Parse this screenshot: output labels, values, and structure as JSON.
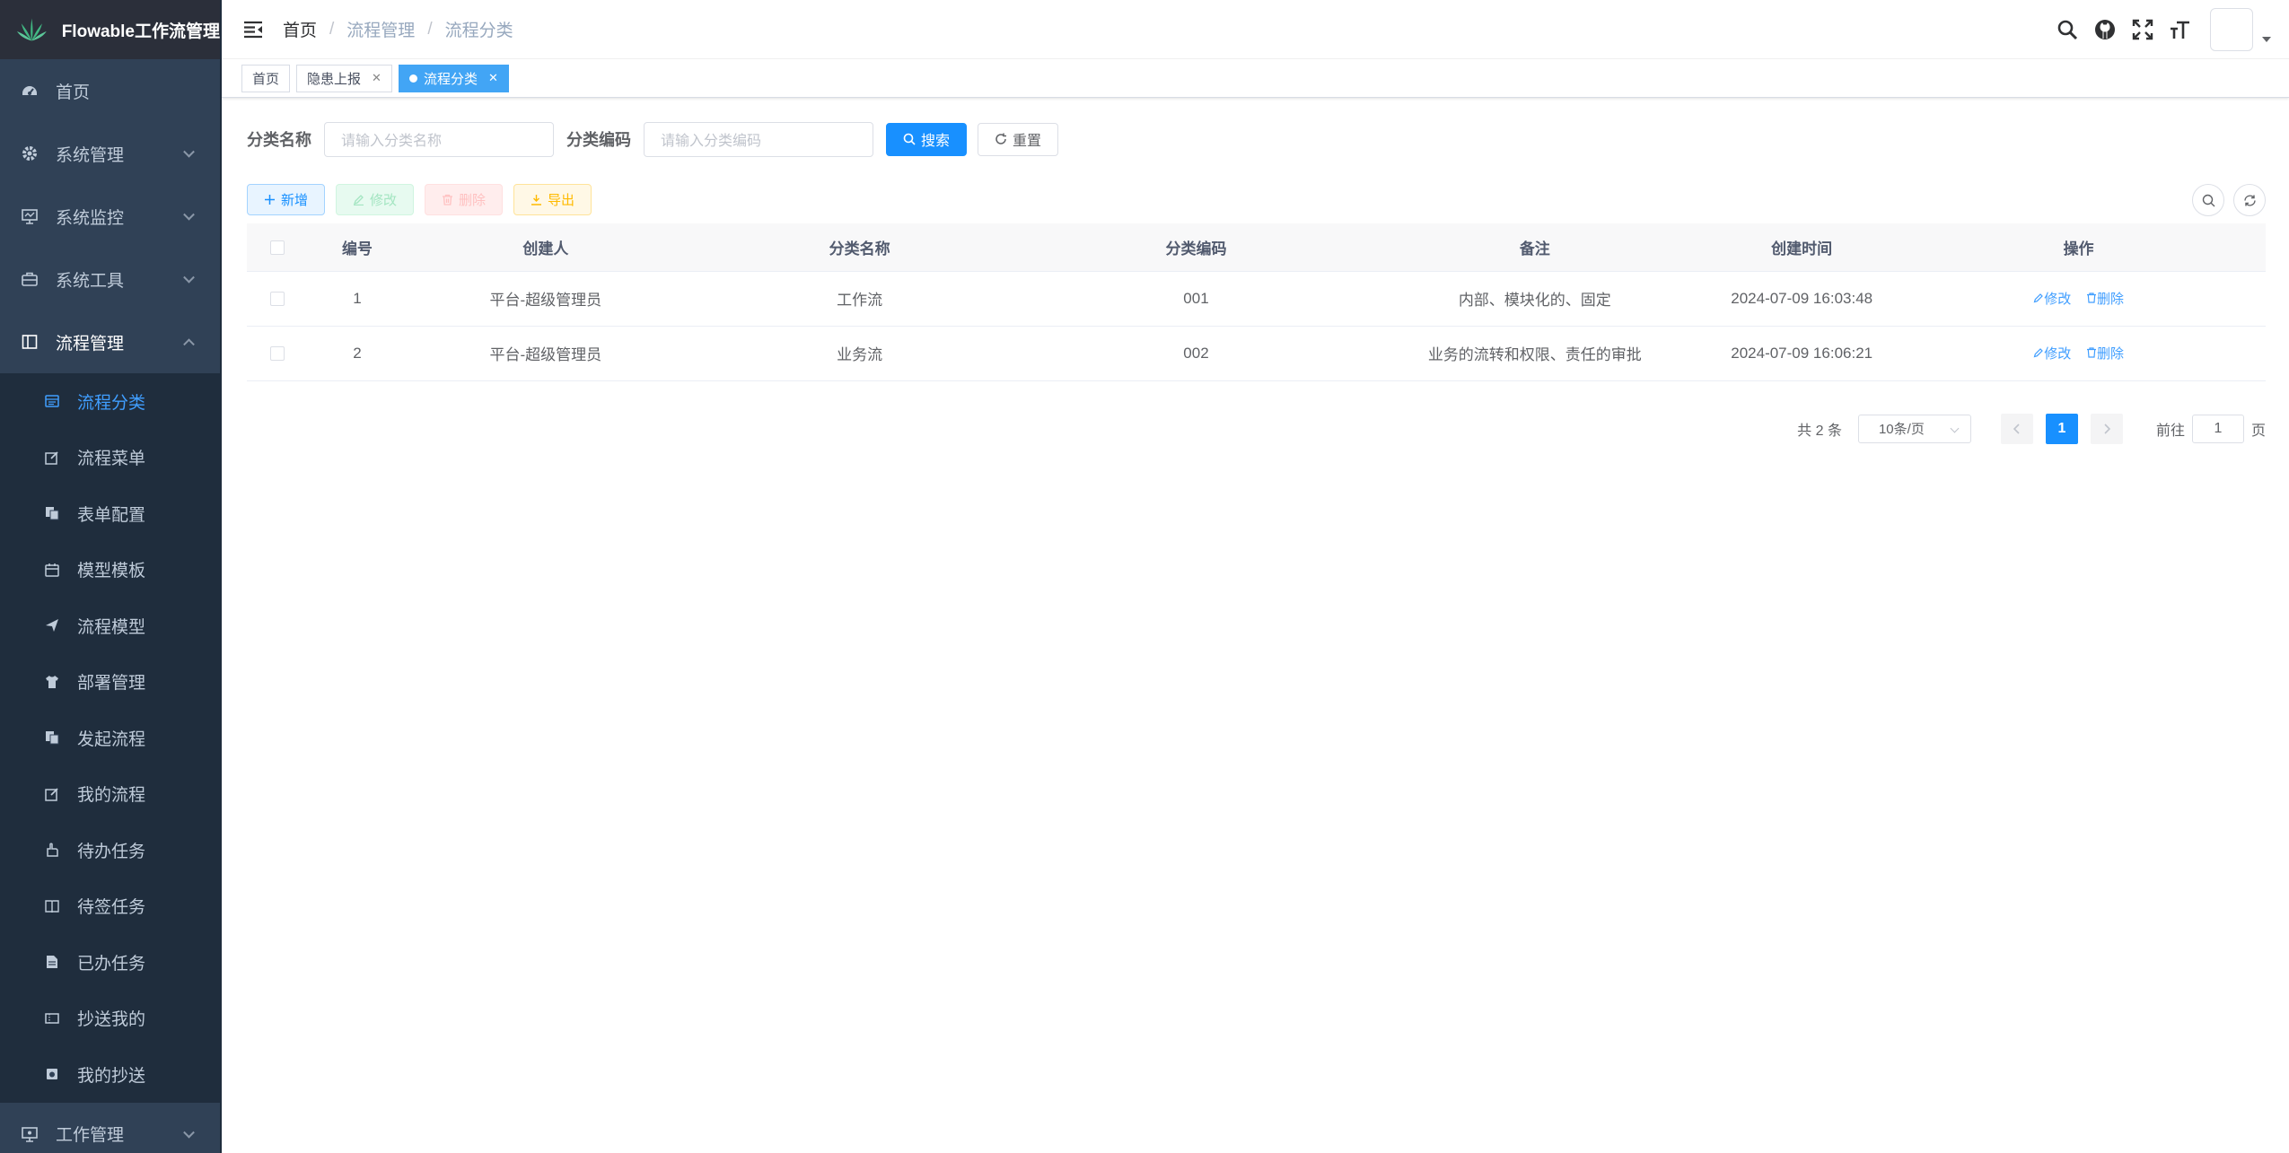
{
  "app": {
    "title": "Flowable工作流管理"
  },
  "sidebar": {
    "items": [
      {
        "label": "首页",
        "icon": "dashboard-icon"
      },
      {
        "label": "系统管理",
        "icon": "gear-icon"
      },
      {
        "label": "系统监控",
        "icon": "monitor-icon"
      },
      {
        "label": "系统工具",
        "icon": "toolbox-icon"
      },
      {
        "label": "流程管理",
        "icon": "layout-icon"
      }
    ],
    "submenu": [
      {
        "label": "流程分类",
        "icon": "list-icon"
      },
      {
        "label": "流程菜单",
        "icon": "edit-icon"
      },
      {
        "label": "表单配置",
        "icon": "copy-icon"
      },
      {
        "label": "模型模板",
        "icon": "calendar-icon"
      },
      {
        "label": "流程模型",
        "icon": "send-icon"
      },
      {
        "label": "部署管理",
        "icon": "shirt-icon"
      },
      {
        "label": "发起流程",
        "icon": "copy-icon"
      },
      {
        "label": "我的流程",
        "icon": "edit-icon"
      },
      {
        "label": "待办任务",
        "icon": "pointer-icon"
      },
      {
        "label": "待签任务",
        "icon": "book-icon"
      },
      {
        "label": "已办任务",
        "icon": "document-icon"
      },
      {
        "label": "抄送我的",
        "icon": "ticket-icon"
      },
      {
        "label": "我的抄送",
        "icon": "camera-icon"
      }
    ],
    "bottom": {
      "label": "工作管理",
      "icon": "monitor-icon"
    }
  },
  "breadcrumb": [
    "首页",
    "流程管理",
    "流程分类"
  ],
  "tags": [
    {
      "label": "首页"
    },
    {
      "label": "隐患上报"
    },
    {
      "label": "流程分类"
    }
  ],
  "search": {
    "name_label": "分类名称",
    "name_placeholder": "请输入分类名称",
    "code_label": "分类编码",
    "code_placeholder": "请输入分类编码",
    "search_btn": "搜索",
    "reset_btn": "重置"
  },
  "toolbar": {
    "add": "新增",
    "edit": "修改",
    "delete": "删除",
    "export": "导出"
  },
  "table": {
    "columns": [
      "编号",
      "创建人",
      "分类名称",
      "分类编码",
      "备注",
      "创建时间",
      "操作"
    ],
    "rows": [
      {
        "id": "1",
        "creator": "平台-超级管理员",
        "name": "工作流",
        "code": "001",
        "remark": "内部、模块化的、固定",
        "created": "2024-07-09 16:03:48"
      },
      {
        "id": "2",
        "creator": "平台-超级管理员",
        "name": "业务流",
        "code": "002",
        "remark": "业务的流转和权限、责任的审批",
        "created": "2024-07-09 16:06:21"
      }
    ],
    "row_actions": {
      "edit": "修改",
      "delete": "删除"
    }
  },
  "pagination": {
    "total_text": "共 2 条",
    "page_size": "10条/页",
    "current_page": "1",
    "goto_prefix": "前往",
    "goto_value": "1",
    "goto_suffix": "页"
  },
  "colors": {
    "primary": "#1890ff",
    "sidebar_bg": "#304156",
    "sidebar_active": "#409eff"
  }
}
